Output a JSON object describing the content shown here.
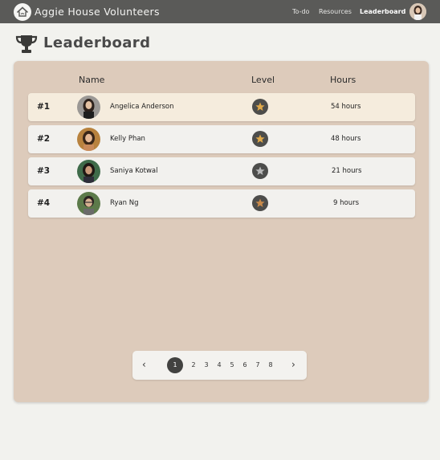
{
  "nav": {
    "brand": "Aggie House Volunteers",
    "links": [
      {
        "label": "To-do"
      },
      {
        "label": "Resources"
      },
      {
        "label": "Leaderboard",
        "active": true
      }
    ]
  },
  "page": {
    "title": "Leaderboard"
  },
  "table": {
    "headers": {
      "name": "Name",
      "level": "Level",
      "hours": "Hours"
    },
    "rows": [
      {
        "rank": "#1",
        "name": "Angelica Anderson",
        "hours": "54 hours",
        "level_color": "#e0a94a"
      },
      {
        "rank": "#2",
        "name": "Kelly Phan",
        "hours": "48 hours",
        "level_color": "#e0a94a"
      },
      {
        "rank": "#3",
        "name": "Saniya Kotwal",
        "hours": "21 hours",
        "level_color": "#b8b8b8"
      },
      {
        "rank": "#4",
        "name": "Ryan Ng",
        "hours": "9 hours",
        "level_color": "#c98a4a"
      }
    ]
  },
  "pagination": {
    "prev": "‹",
    "next": "›",
    "pages": [
      "1",
      "2",
      "3",
      "4",
      "5",
      "6",
      "7",
      "8"
    ],
    "current": "1"
  },
  "colors": {
    "nav_bg": "#5a5a58",
    "card_bg": "#ddcbbb",
    "first_row_bg": "#f5ecdd",
    "star_gold": "#e0a94a",
    "star_silver": "#b8b8b8",
    "star_bronze": "#c98a4a"
  }
}
